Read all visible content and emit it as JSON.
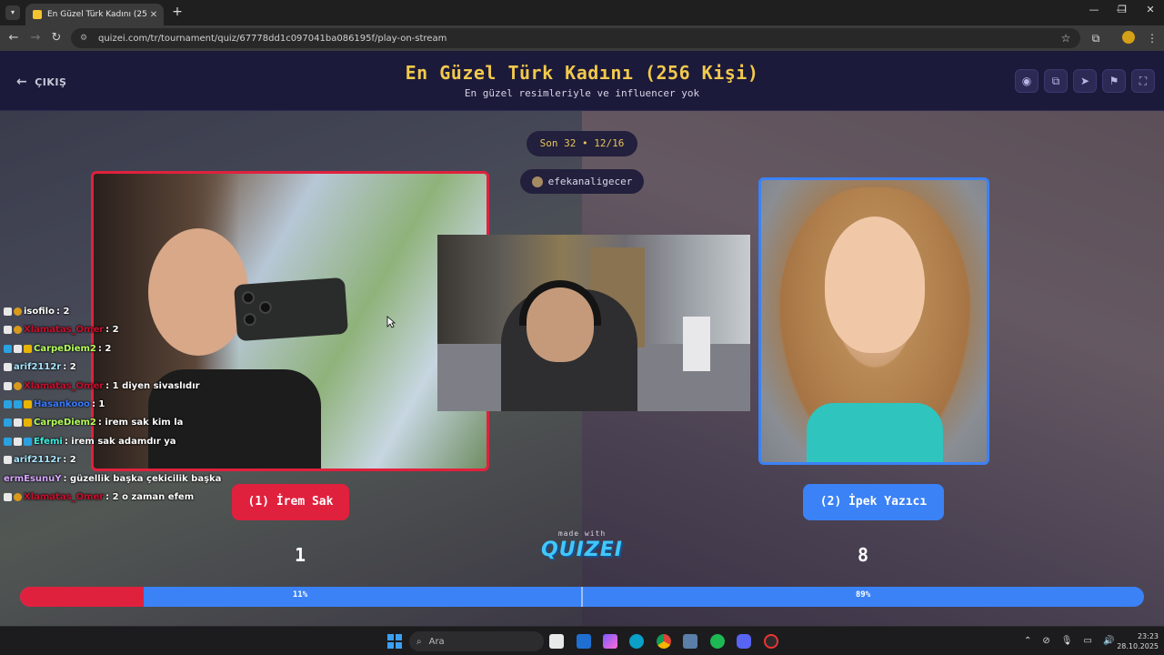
{
  "browser": {
    "tab_title": "En Güzel Türk Kadını (256 Kişi)",
    "tab_close": "✕",
    "new_tab": "+",
    "url": "quizei.com/tr/tournament/quiz/67778dd1c097041ba086195f/play-on-stream",
    "window_controls": [
      "—",
      "❐",
      "✕"
    ]
  },
  "header": {
    "exit_label": "ÇIKIŞ",
    "title": "En Güzel Türk Kadını (256 Kişi)",
    "subtitle": "En güzel resimleriyle ve influencer yok",
    "icons": [
      "eye-icon",
      "share-icon",
      "send-icon",
      "flag-icon",
      "fullscreen-icon"
    ]
  },
  "round": {
    "label": "Son 32 • 12/16"
  },
  "streamer": {
    "name": "efekanaligecer"
  },
  "contestants": {
    "left": {
      "label": "(1) İrem Sak",
      "votes": "1",
      "percent": "11%",
      "percent_value": 11,
      "color": "#e0213d"
    },
    "right": {
      "label": "(2) İpek Yazıcı",
      "votes": "8",
      "percent": "89%",
      "percent_value": 89,
      "color": "#3b82f6"
    }
  },
  "made_with": "made with",
  "brand": "QUIZEI",
  "chat": [
    {
      "user": "isofilo",
      "color": "#ffffff",
      "badges": [
        "w",
        "o"
      ],
      "message": ": 2"
    },
    {
      "user": "Xlamatas_Omer",
      "color": "#c8102e",
      "badges": [
        "w",
        "o"
      ],
      "message": ": 2"
    },
    {
      "user": "CarpeDiem2",
      "color": "#b6ff5c",
      "badges": [
        "b",
        "w",
        "y"
      ],
      "message": ": 2"
    },
    {
      "user": "arif2112r",
      "color": "#a8e6ff",
      "badges": [
        "w"
      ],
      "message": ": 2"
    },
    {
      "user": "Xlamatas_Omer",
      "color": "#c8102e",
      "badges": [
        "w",
        "o"
      ],
      "message": ": 1 diyen sivaslıdır"
    },
    {
      "user": "Hasankooo",
      "color": "#3a7bff",
      "badges": [
        "b",
        "b",
        "y"
      ],
      "message": ": 1"
    },
    {
      "user": "CarpeDiem2",
      "color": "#b6ff5c",
      "badges": [
        "b",
        "w",
        "y"
      ],
      "message": ": irem sak kim la"
    },
    {
      "user": "Efemi",
      "color": "#3cf0e0",
      "badges": [
        "b",
        "w",
        "b"
      ],
      "message": ": irem sak adamdır ya"
    },
    {
      "user": "arif2112r",
      "color": "#a8e6ff",
      "badges": [
        "w"
      ],
      "message": ": 2"
    },
    {
      "user": "ermEsunuY",
      "color": "#d7a6ff",
      "badges": [],
      "message": ": güzellik başka çekicilik başka"
    },
    {
      "user": "Xlamatas_Omer",
      "color": "#c8102e",
      "badges": [
        "w",
        "o"
      ],
      "message": ": 2 o zaman efem"
    }
  ],
  "taskbar": {
    "search_placeholder": "Ara",
    "time": "23:23",
    "date": "28.10.2025"
  }
}
